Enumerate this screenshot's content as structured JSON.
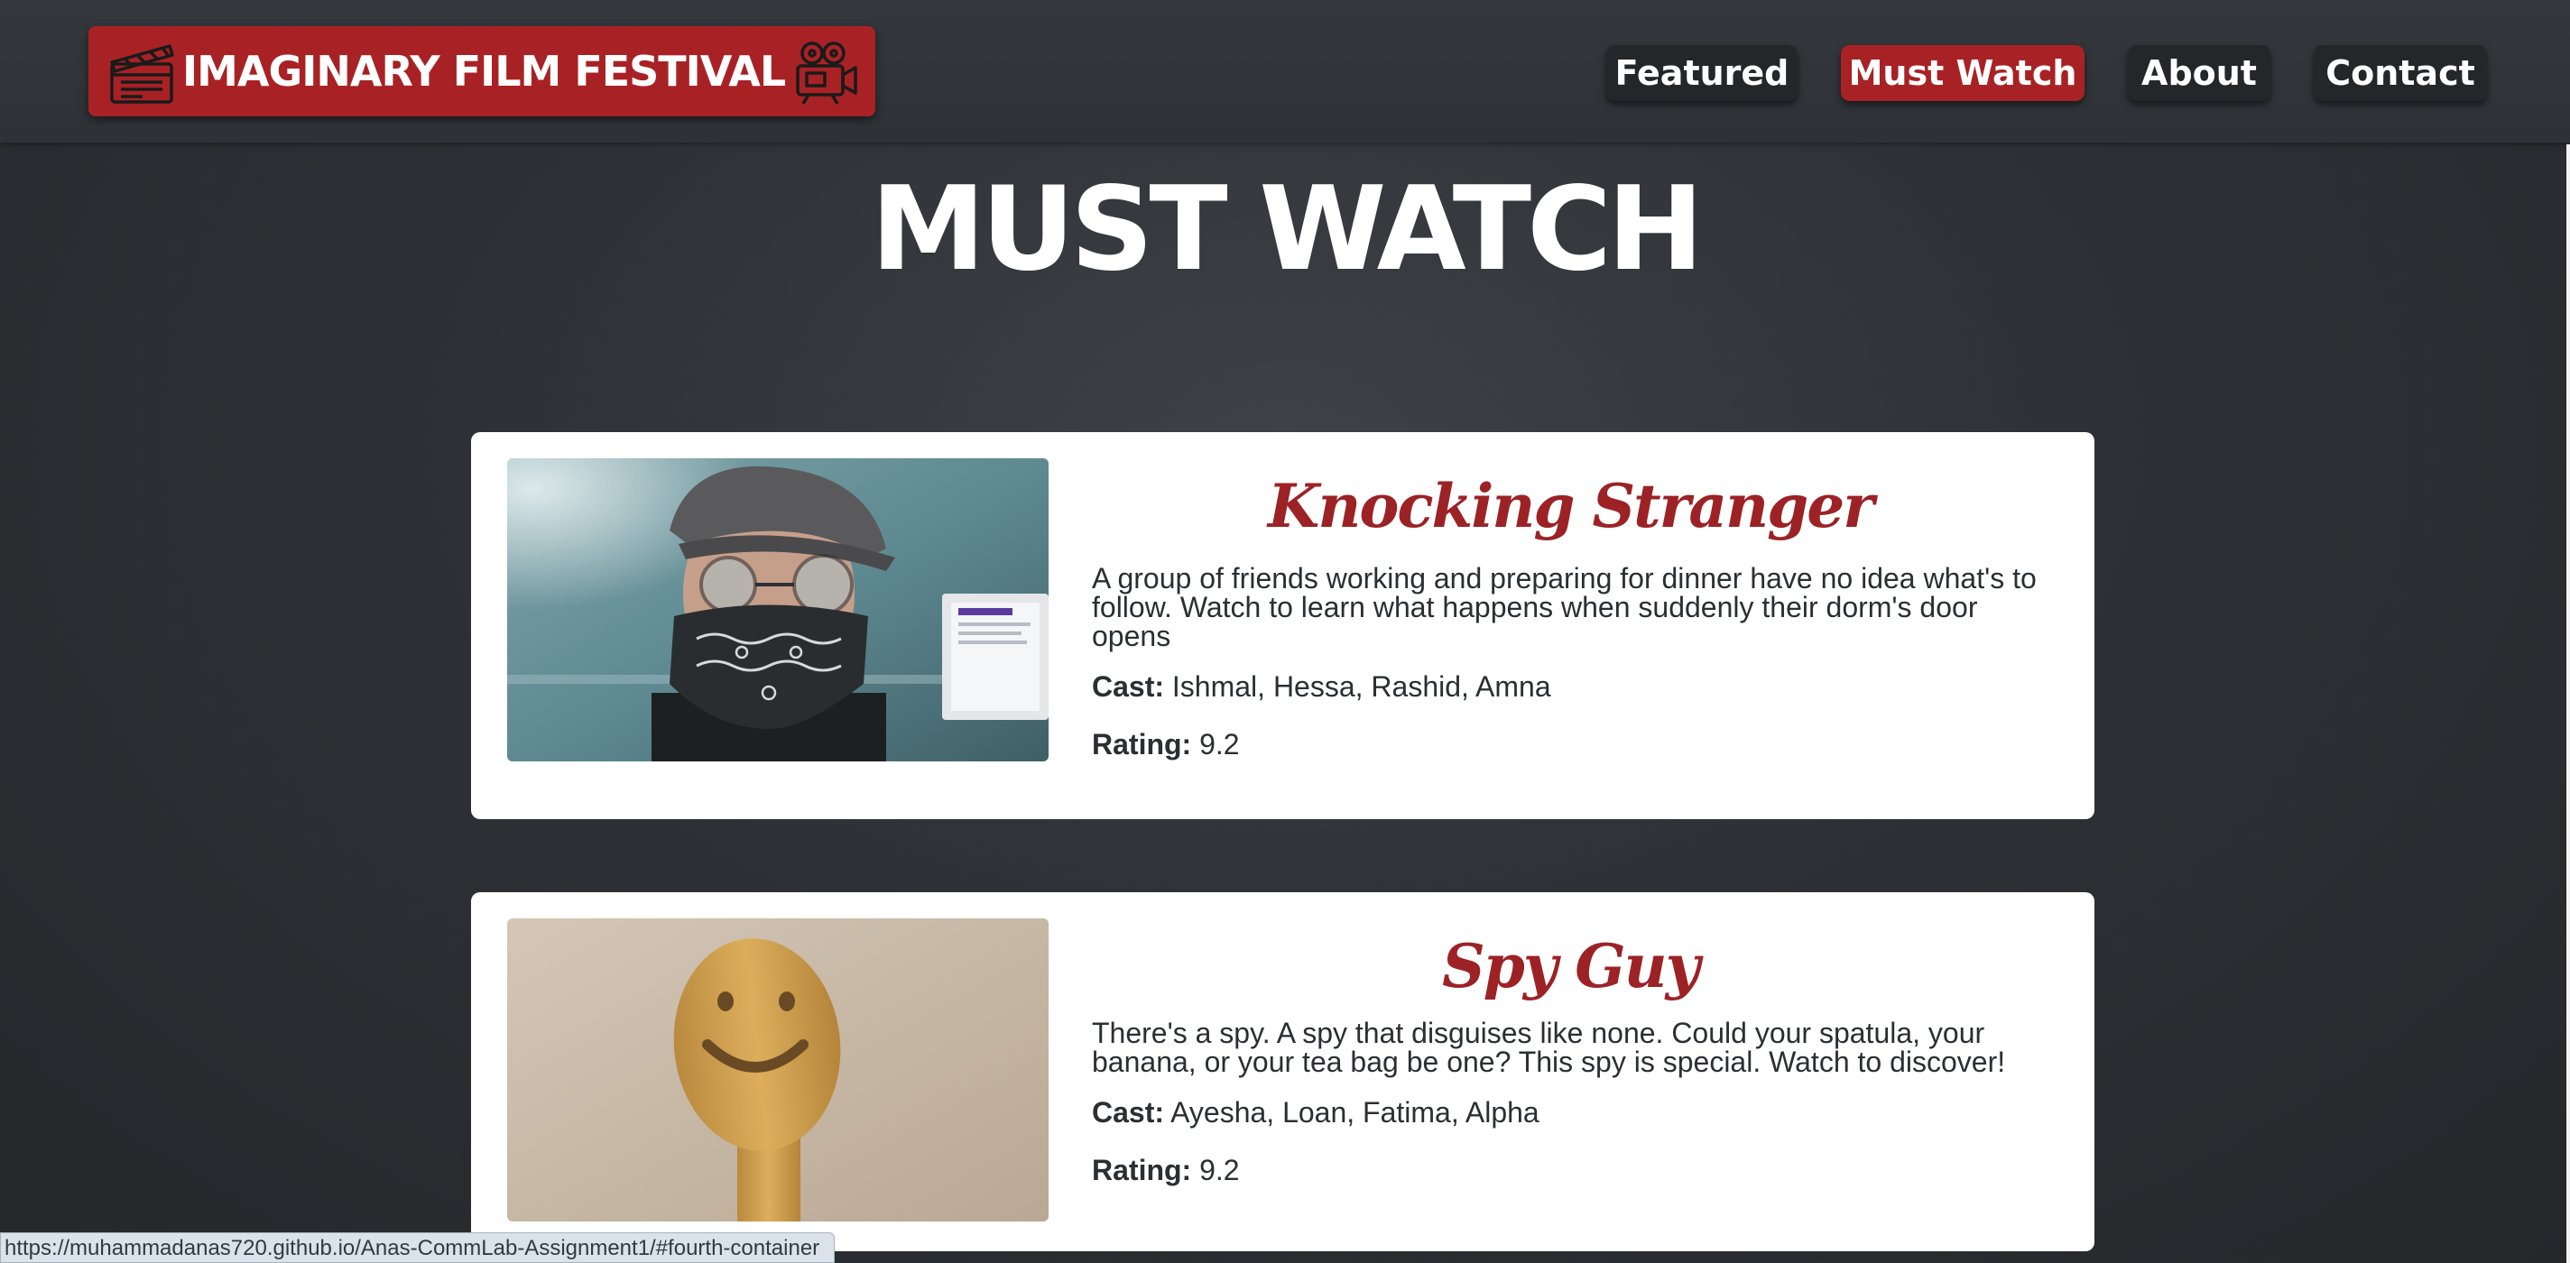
{
  "header": {
    "logo_text": "IMAGINARY FILM FESTIVAL",
    "nav": [
      {
        "label": "Featured",
        "active": false
      },
      {
        "label": "Must Watch",
        "active": true
      },
      {
        "label": "About",
        "active": false
      },
      {
        "label": "Contact",
        "active": false
      }
    ]
  },
  "page_title": "MUST WATCH",
  "movies": [
    {
      "title": "Knocking Stranger",
      "description": "A group of friends working and preparing for dinner have no idea what's to follow. Watch to learn what happens when suddenly their dorm's door opens",
      "cast_label": "Cast:",
      "cast": "Ishmal, Hessa, Rashid, Amna",
      "rating_label": "Rating:",
      "rating": "9.2"
    },
    {
      "title": "Spy Guy",
      "description": "There's a spy. A spy that disguises like none. Could your spatula, your banana, or your tea bag be one? This spy is special. Watch to discover!",
      "cast_label": "Cast:",
      "cast": "Ayesha, Loan, Fatima, Alpha",
      "rating_label": "Rating:",
      "rating": "9.2"
    }
  ],
  "status_bar": {
    "url": "https://muhammadanas720.github.io/Anas-CommLab-Assignment1/#fourth-container"
  },
  "colors": {
    "brand_red": "#a82225",
    "title_red": "#9c2226",
    "nav_dark": "#24272a",
    "background": "#2d3135"
  },
  "icons": {
    "logo_left": "clapperboard-icon",
    "logo_right": "movie-camera-icon"
  }
}
